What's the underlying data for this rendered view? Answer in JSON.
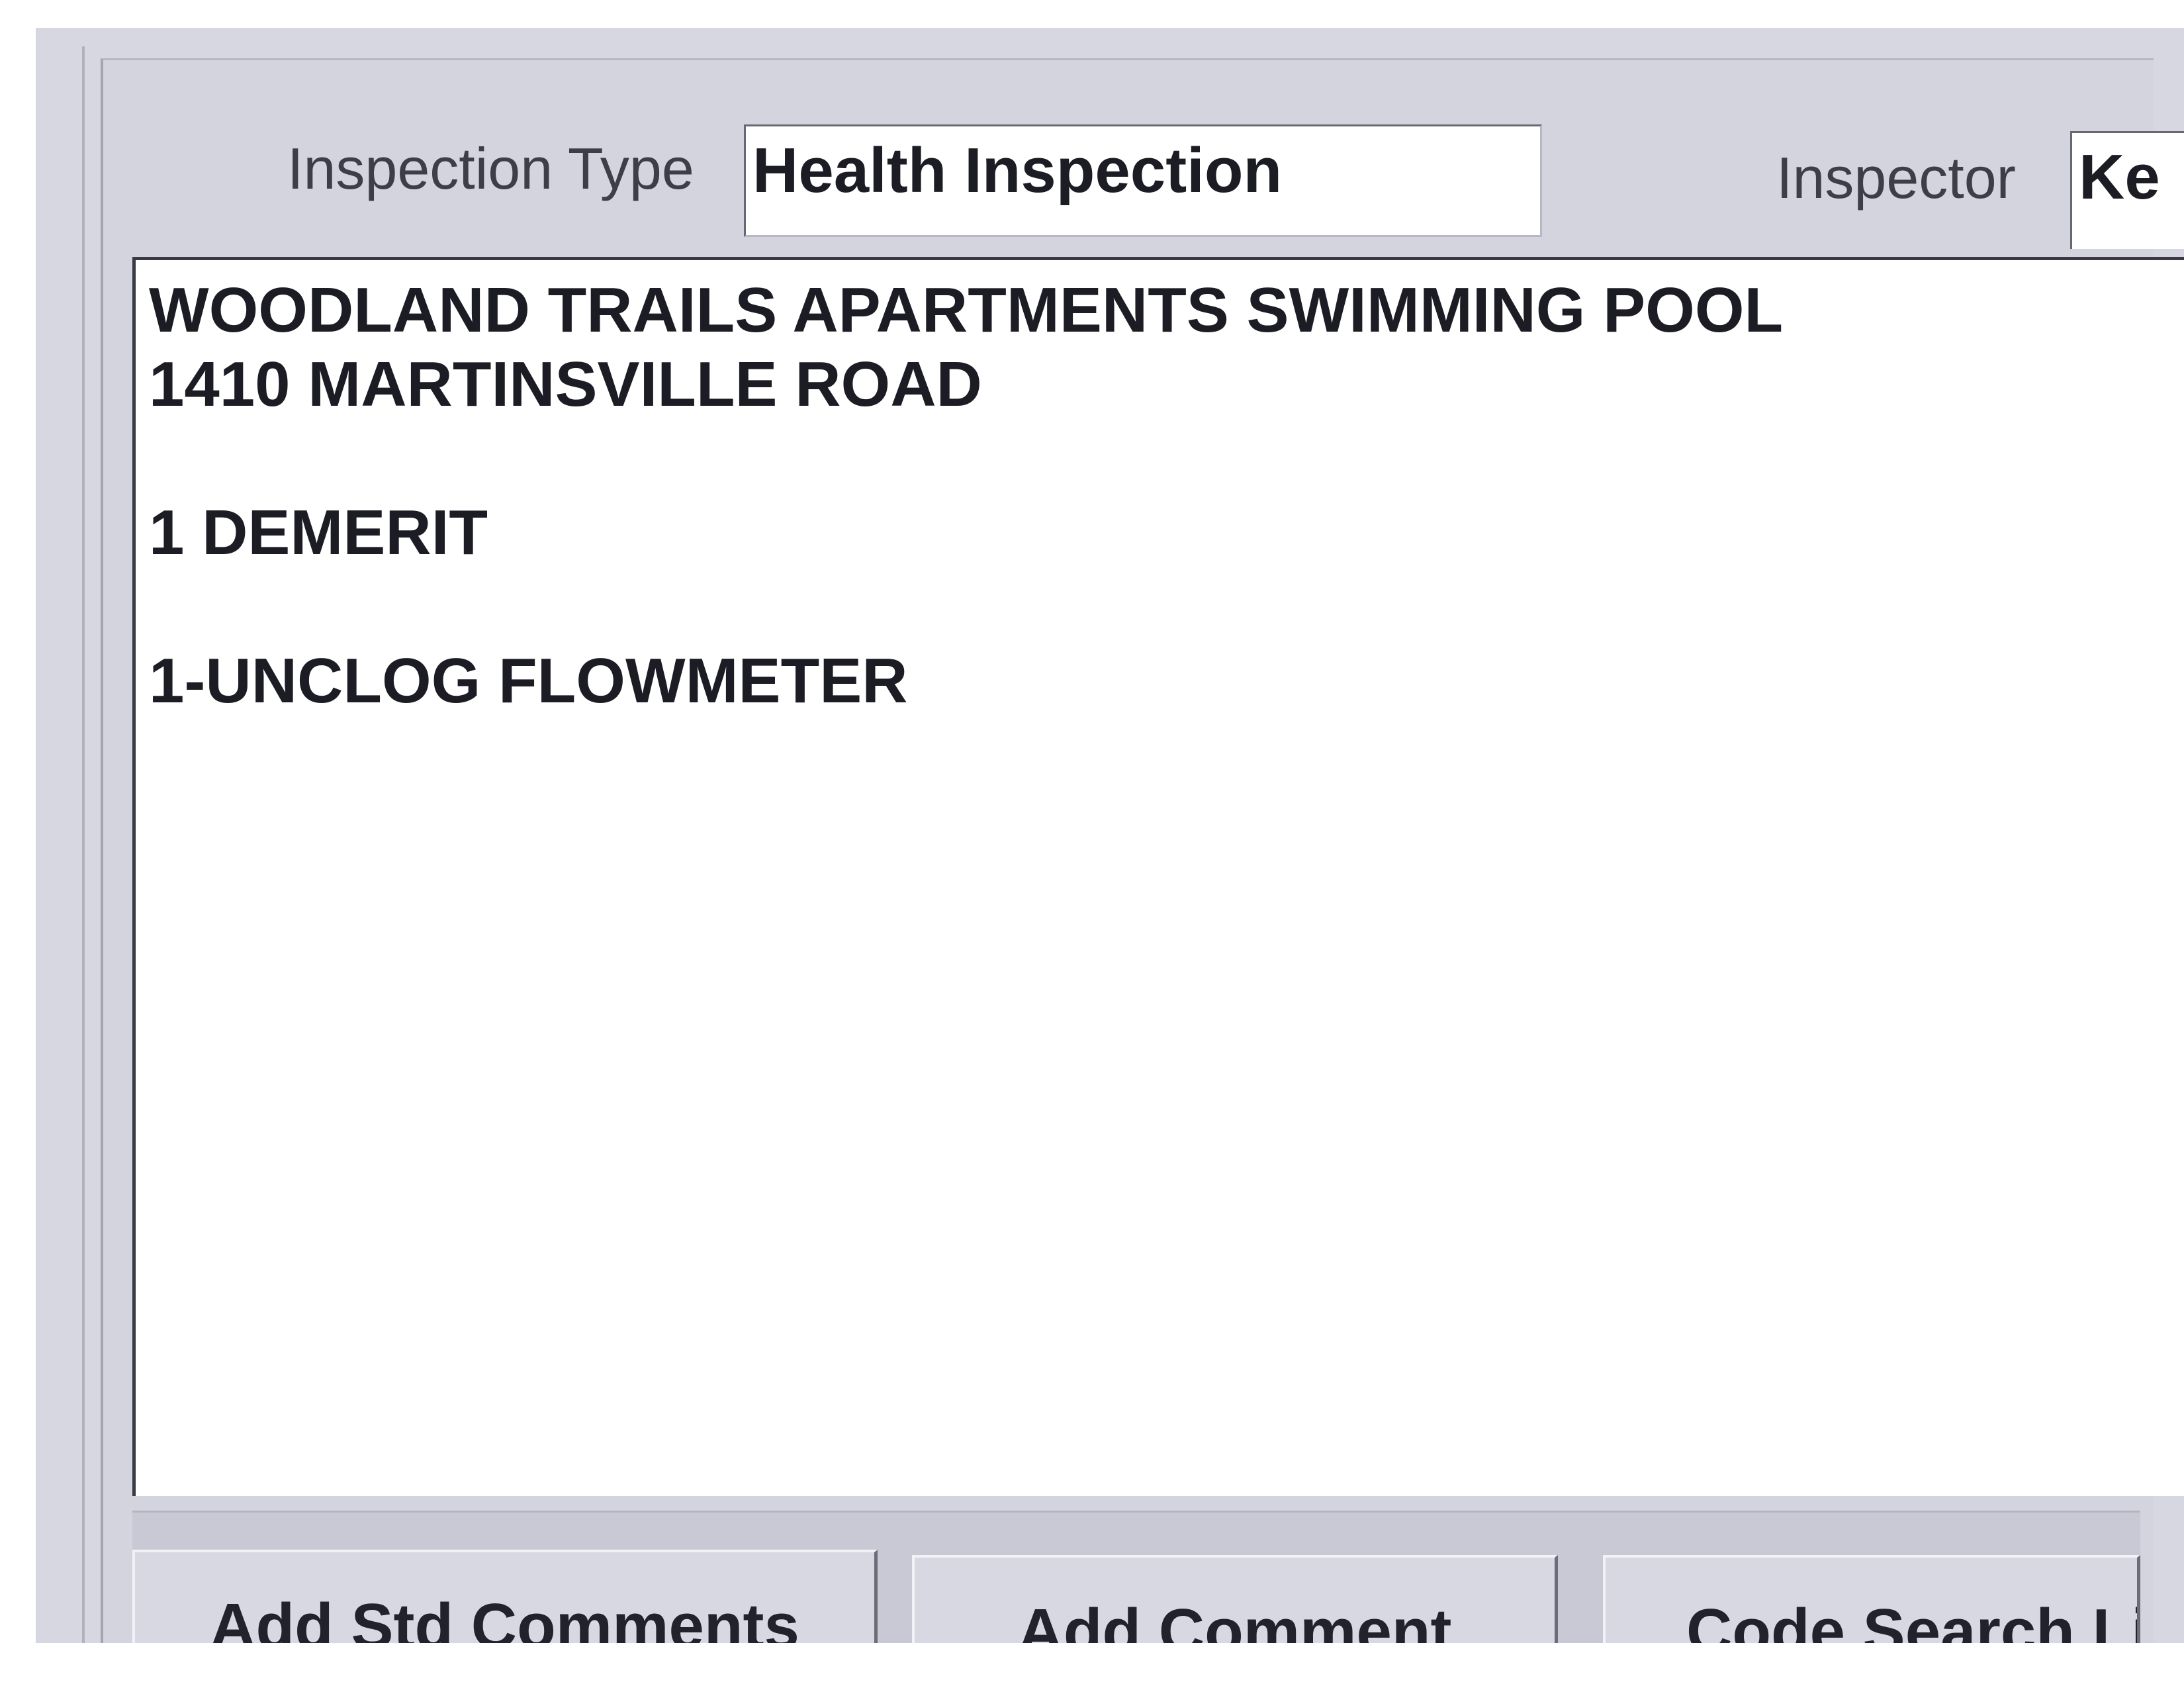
{
  "form": {
    "inspection_type_label": "Inspection Type",
    "inspection_type_value": "Health Inspection",
    "inspector_label": "Inspector",
    "inspector_value": "Ke"
  },
  "comments": {
    "lines": [
      "WOODLAND TRAILS APARTMENTS SWIMMING POOL",
      "1410 MARTINSVILLE ROAD",
      "",
      "1 DEMERIT",
      "",
      "1-UNCLOG FLOWMETER"
    ]
  },
  "buttons": {
    "add_std_comments": {
      "before": "Add ",
      "mnemonic": "S",
      "after": "td Comments"
    },
    "add_comment": {
      "before": "",
      "mnemonic": "A",
      "after": "dd Comment"
    },
    "code_search": {
      "label": "Code Search Li"
    }
  },
  "colors": {
    "panel": "#d4d4df",
    "field_bg": "#ffffff",
    "text": "#1c1c24"
  }
}
